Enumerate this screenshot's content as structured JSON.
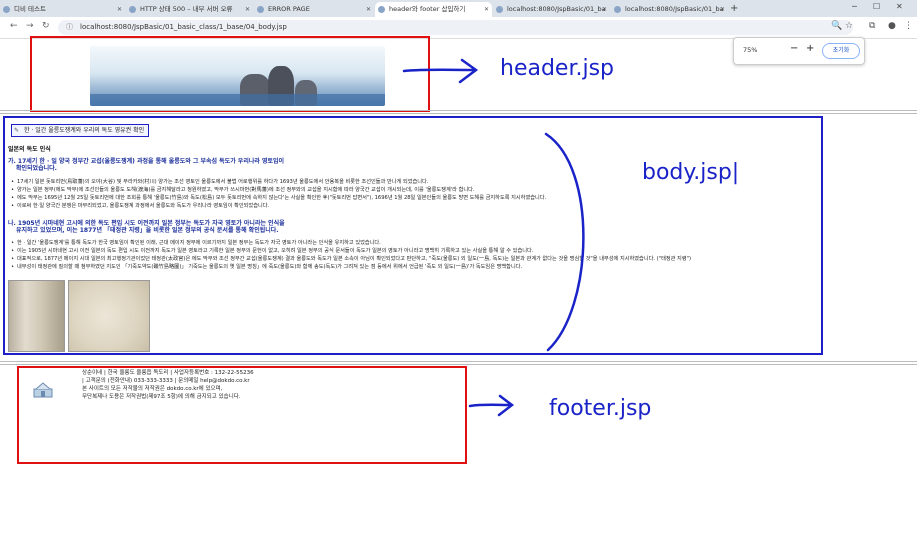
{
  "browser": {
    "tabs": [
      {
        "label": "디비 테스트",
        "active": false
      },
      {
        "label": "HTTP 상태 500 – 내부 서버 오류",
        "active": false
      },
      {
        "label": "ERROR PAGE",
        "active": false
      },
      {
        "label": "header와 footer 삽입하기",
        "active": true
      },
      {
        "label": "localhost:8080/JspBasic/01_ba",
        "active": false
      },
      {
        "label": "localhost:8080/JspBasic/01_ba",
        "active": false
      }
    ],
    "url": "localhost:8080/JspBasic/01_basic_class/1_base/04_body.jsp",
    "zoom_popup": {
      "level": "75%",
      "minus": "−",
      "plus": "+",
      "reset": "초기화"
    }
  },
  "annotations": {
    "header_label": "header.jsp",
    "body_label": "body.jsp|",
    "footer_label": "footer.jsp"
  },
  "body": {
    "crumb": "한 · 일간 울릉도쟁계와 우리의 독도 영유권 확인",
    "heading": "일본의 독도 인식",
    "section1_title": "가. 17세기 한 · 일 양국 정부간 교섭(울릉도쟁계) 과정을 통해 울릉도와 그 부속섬 독도가 우리나라 영토임이",
    "section1_title2": "확인되었습니다.",
    "bullets1": [
      "17세기 일본 돗토리번(鳥取藩)의 오야(大谷) 및 무라카와(村川) 양가는 조선 영토인 울릉도에서 불법 어로행위를 하다가 1693년 울릉도에서 안용복을 비롯한 조선인들과 만나게 되었습니다.",
      "양가는 일본 정부(에도 막부)에 조선인들의 울릉도 도해(渡海)를 금지해달라고 청원하였고, 막부가 쓰시마번(對馬藩)에 조선 정부와의 교섭을 지시함에 따라 양국간 교섭이 개시되는데, 이를 '울릉도쟁계'라 합니다.",
      "에도 막부는 1695년 12월 25일 돗토리번에 대한 조회를 통해 '울릉도(竹島)와 독도(松島) 모두 돗토리번에 속하지 않는다'는 사실을 확인한 후(\"돗토리번 답변서\"), 1696년 1월 28일 일본인들의 울릉도 방면 도해를 금지하도록 지시하였습니다.",
      "이로써 한·일 양국간 분쟁은 마무리되었고, 울릉도쟁계 과정에서 울릉도와 독도가 우리나라 영토임이 확인되었습니다."
    ],
    "section2_title": "나. 1905년 시마네현 고시에 의한 독도 편입 시도 이전까지 일본 정부는 독도가 자국 영토가 아니라는 인식을",
    "section2_title2": "유지하고 있었으며, 이는 1877년 「태정관 지령」을 비롯한 일본 정부의 공식 문서를 통해 확인됩니다.",
    "bullets2": [
      "한 · 일간 '울릉도쟁계'를 통해 독도가 한국 영토임이 확인된 이래, 근대 메이지 정부에 이르기까지 일본 정부는 독도가 자국 영토가 아니라는 인식을 유지하고 있었습니다.",
      "이는 1905년 시마네현 고시 이전 일본의 독도 편입 시도 이전까지 독도가 일본 영토라고 기록한 일본 정부의 문헌이 없고, 오히려 일본 정부의 공식 문서들이 독도가 일본의 영토가 아니라고 명백히 기록하고 있는 사실을 통해 알 수 있습니다.",
      "대표적으로, 1877년 메이지 시대 일본의 최고행정기관이었던 태정관(太政官)은 에도 막부와 조선 정부간 교섭(울릉도쟁계) 결과 울릉도와 독도가 일본 소속이 아님이 확인되었다고 판단하고, \"죽도(울릉도) 외 일도(一島, 독도)는 일본과 관계가 없다는 것을 명심할 것\"을 내무성에 지시하였습니다. (\"태정관 지령\")",
      "내무성이 태정관에 질의할 때 첨부하였던 지도인 「기죽도약도(磯竹島略圖)」 기죽도는 울릉도의 옛 일본 명칭」에 죽도(울릉도)와 함께 송도(독도)가 그려져 있는 점 등에서 위에서 언급된 '죽도 외 일도(一島)'가 독도임은 명백합니다."
    ]
  },
  "footer": {
    "line1": "상순이네 | 한국 울릉도 울릉읍 독도리 | 사업자등록번호 : 132-22-55236",
    "line2": "| 고객문의 (전화안내) 033-333-3333 | 문의메일 help@dokdo.co.kr",
    "line3": "본 사이트의 모든 저작물의 저작권은 dokdo.co.kr에 있으며,",
    "line4": "무단복제나 도용은 저작권법(제97조 5항)에 의해 금지되고 있습니다."
  },
  "colors": {
    "red": "#e01010",
    "blue": "#1f1fc8"
  }
}
